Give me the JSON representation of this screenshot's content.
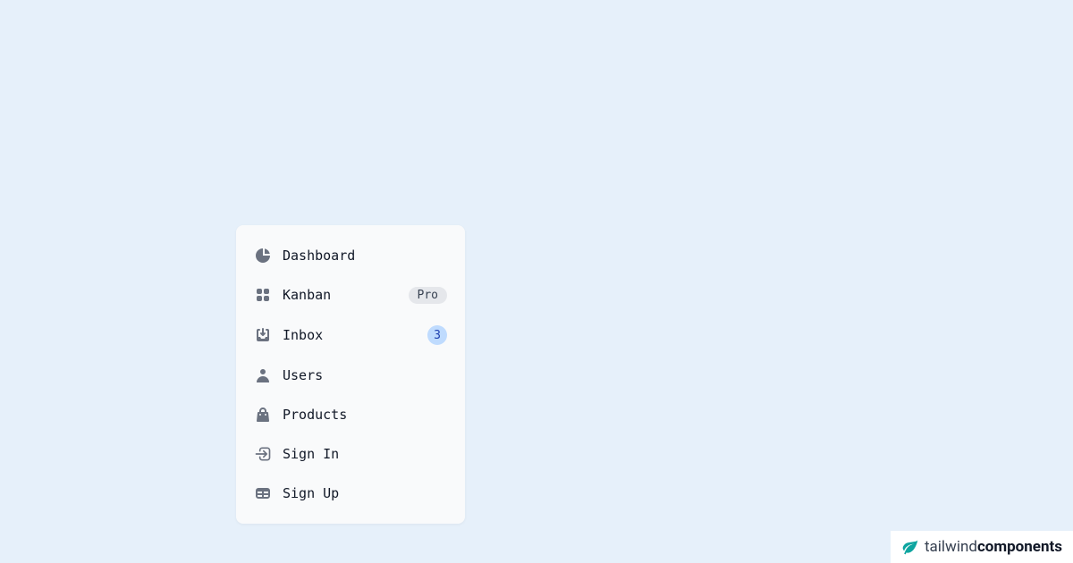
{
  "sidebar": {
    "items": [
      {
        "label": "Dashboard",
        "icon": "chart-pie-icon"
      },
      {
        "label": "Kanban",
        "icon": "grid-icon",
        "badge_pro": "Pro"
      },
      {
        "label": "Inbox",
        "icon": "inbox-in-icon",
        "badge_count": "3"
      },
      {
        "label": "Users",
        "icon": "user-icon"
      },
      {
        "label": "Products",
        "icon": "shopping-bag-icon"
      },
      {
        "label": "Sign In",
        "icon": "arrow-right-icon"
      },
      {
        "label": "Sign Up",
        "icon": "table-icon"
      }
    ]
  },
  "brand": {
    "light": "tailwind",
    "bold": "components"
  }
}
